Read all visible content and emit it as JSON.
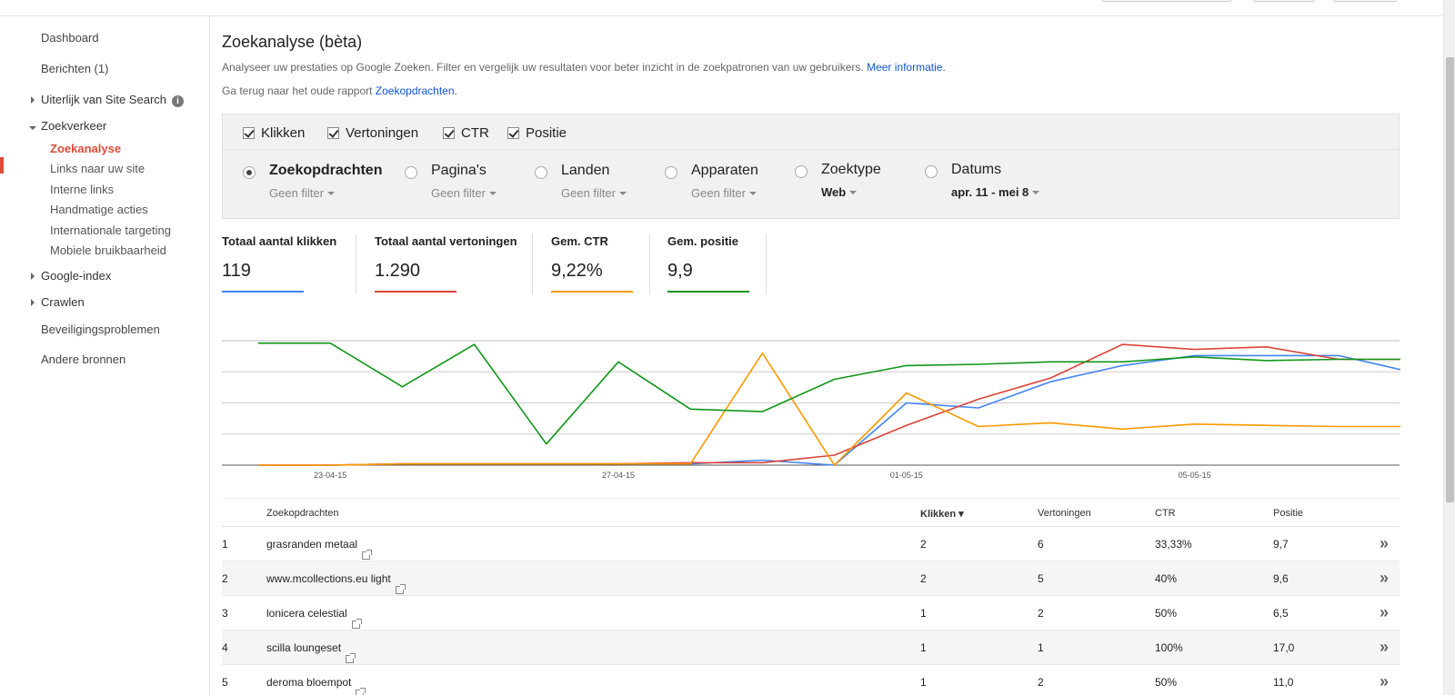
{
  "sidebar": {
    "items": [
      {
        "label": "Dashboard"
      },
      {
        "label": "Berichten (1)"
      },
      {
        "label": "Uiterlijk van Site Search"
      },
      {
        "label": "Zoekverkeer"
      },
      {
        "label": "Zoekanalyse"
      },
      {
        "label": "Links naar uw site"
      },
      {
        "label": "Interne links"
      },
      {
        "label": "Handmatige acties"
      },
      {
        "label": "Internationale targeting"
      },
      {
        "label": "Mobiele bruikbaarheid"
      },
      {
        "label": "Google-index"
      },
      {
        "label": "Crawlen"
      },
      {
        "label": "Beveiligingsproblemen"
      },
      {
        "label": "Andere bronnen"
      }
    ]
  },
  "header": {
    "title": "Zoekanalyse (bèta)",
    "description": "Analyseer uw prestaties op Google Zoeken. Filter en vergelijk uw resultaten voor beter inzicht in de zoekpatronen van uw gebruikers.",
    "more_info_link": "Meer informatie.",
    "back_text": "Ga terug naar het oude rapport",
    "back_link": "Zoekopdrachten."
  },
  "metrics": [
    {
      "label": "Klikken",
      "checked": true
    },
    {
      "label": "Vertoningen",
      "checked": true
    },
    {
      "label": "CTR",
      "checked": true
    },
    {
      "label": "Positie",
      "checked": true
    }
  ],
  "filters": [
    {
      "label": "Zoekopdrachten",
      "sub": "Geen filter",
      "selected": true
    },
    {
      "label": "Pagina's",
      "sub": "Geen filter",
      "selected": false
    },
    {
      "label": "Landen",
      "sub": "Geen filter",
      "selected": false
    },
    {
      "label": "Apparaten",
      "sub": "Geen filter",
      "selected": false
    },
    {
      "label": "Zoektype",
      "sub": "Web",
      "selected": false
    },
    {
      "label": "Datums",
      "sub": "apr. 11 - mei 8",
      "selected": false
    }
  ],
  "totals": [
    {
      "label": "Totaal aantal klikken",
      "value": "119",
      "color": "#4285f4"
    },
    {
      "label": "Totaal aantal vertoningen",
      "value": "1.290",
      "color": "#db4437"
    },
    {
      "label": "Gem. CTR",
      "value": "9,22%",
      "color": "#ff9900"
    },
    {
      "label": "Gem. positie",
      "value": "9,9",
      "color": "#109618"
    }
  ],
  "chart_data": {
    "type": "line",
    "x_ticks": [
      "23-04-15",
      "27-04-15",
      "01-05-15",
      "05-05-15"
    ],
    "x": [
      "22-04-15",
      "23-04-15",
      "24-04-15",
      "25-04-15",
      "26-04-15",
      "27-04-15",
      "28-04-15",
      "29-04-15",
      "30-04-15",
      "01-05-15",
      "02-05-15",
      "03-05-15",
      "04-05-15",
      "05-05-15",
      "06-05-15",
      "07-05-15",
      "08-05-15"
    ],
    "series": [
      {
        "color": "#4285f4",
        "values": [
          0,
          0,
          0.01,
          0.01,
          0.01,
          0.01,
          0.01,
          0.04,
          0,
          0.5,
          0.46,
          0.67,
          0.8,
          0.88,
          0.88,
          0.88,
          0.75
        ]
      },
      {
        "color": "#db4437",
        "values": [
          0,
          0,
          0.01,
          0.01,
          0.01,
          0.01,
          0.02,
          0.02,
          0.08,
          0.32,
          0.53,
          0.7,
          0.97,
          0.93,
          0.95,
          0.85,
          0.85
        ]
      },
      {
        "color": "#ff9900",
        "values": [
          0,
          0,
          0.01,
          0.01,
          0.01,
          0.01,
          0.01,
          0.9,
          0,
          0.58,
          0.31,
          0.34,
          0.29,
          0.33,
          0.32,
          0.31,
          0.31
        ]
      },
      {
        "color": "#109618",
        "values": [
          0.98,
          0.98,
          0.63,
          0.97,
          0.17,
          0.83,
          0.45,
          0.43,
          0.69,
          0.8,
          0.81,
          0.83,
          0.83,
          0.87,
          0.84,
          0.85,
          0.85
        ]
      }
    ]
  },
  "table": {
    "headers": {
      "query": "Zoekopdrachten",
      "clicks": "Klikken ▾",
      "impressions": "Vertoningen",
      "ctr": "CTR",
      "position": "Positie"
    },
    "rows": [
      {
        "n": "1",
        "query": "grasranden metaal",
        "clicks": "2",
        "impressions": "6",
        "ctr": "33,33%",
        "position": "9,7"
      },
      {
        "n": "2",
        "query": "www.mcollections.eu light",
        "clicks": "2",
        "impressions": "5",
        "ctr": "40%",
        "position": "9,6"
      },
      {
        "n": "3",
        "query": "lonicera celestial",
        "clicks": "1",
        "impressions": "2",
        "ctr": "50%",
        "position": "6,5"
      },
      {
        "n": "4",
        "query": "scilla loungeset",
        "clicks": "1",
        "impressions": "1",
        "ctr": "100%",
        "position": "17,0"
      },
      {
        "n": "5",
        "query": "deroma bloempot",
        "clicks": "1",
        "impressions": "2",
        "ctr": "50%",
        "position": "11,0"
      }
    ]
  }
}
